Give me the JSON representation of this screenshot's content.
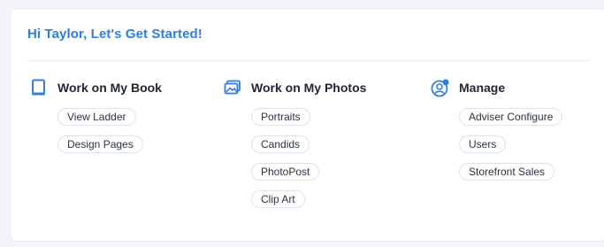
{
  "header": {
    "greeting": "Hi Taylor, Let's Get Started!"
  },
  "columns": {
    "book": {
      "title": "Work on My Book",
      "icon": "book-icon",
      "links": [
        "View Ladder",
        "Design Pages"
      ]
    },
    "photos": {
      "title": "Work on My Photos",
      "icon": "photos-icon",
      "links": [
        "Portraits",
        "Candids",
        "PhotoPost",
        "Clip Art"
      ]
    },
    "manage": {
      "title": "Manage",
      "icon": "user-settings-icon",
      "links": [
        "Adviser Configure",
        "Users",
        "Storefront Sales"
      ]
    }
  },
  "colors": {
    "accent": "#2f7de1",
    "heading": "#1f2733"
  }
}
